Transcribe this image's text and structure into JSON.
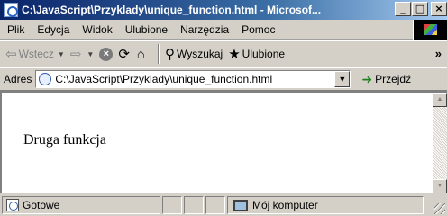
{
  "window": {
    "title": "C:\\JavaScript\\Przyklady\\unique_function.html - Microsof...",
    "buttons": {
      "minimize": "_",
      "maximize": "□",
      "close": "×"
    }
  },
  "menu": {
    "items": [
      {
        "label": "Plik"
      },
      {
        "label": "Edycja"
      },
      {
        "label": "Widok"
      },
      {
        "label": "Ulubione"
      },
      {
        "label": "Narzędzia"
      },
      {
        "label": "Pomoc"
      }
    ]
  },
  "toolbar": {
    "back_label": "Wstecz",
    "search_label": "Wyszukaj",
    "favorites_label": "Ulubione",
    "more": "»"
  },
  "address": {
    "label": "Adres",
    "value": "C:\\JavaScript\\Przyklady\\unique_function.html",
    "go_label": "Przejdź"
  },
  "page": {
    "text": "Druga funkcja"
  },
  "status": {
    "text": "Gotowe",
    "zone": "Mój komputer"
  },
  "icons": {
    "back": "back-arrow-icon",
    "forward": "forward-arrow-icon",
    "stop": "stop-icon",
    "refresh": "refresh-icon",
    "home": "home-icon",
    "search": "search-icon",
    "favorites": "favorites-icon",
    "go": "go-arrow-icon",
    "computer": "computer-icon"
  },
  "colors": {
    "titlebar_start": "#0a246a",
    "titlebar_end": "#a6caf0",
    "chrome": "#d4d0c8"
  }
}
